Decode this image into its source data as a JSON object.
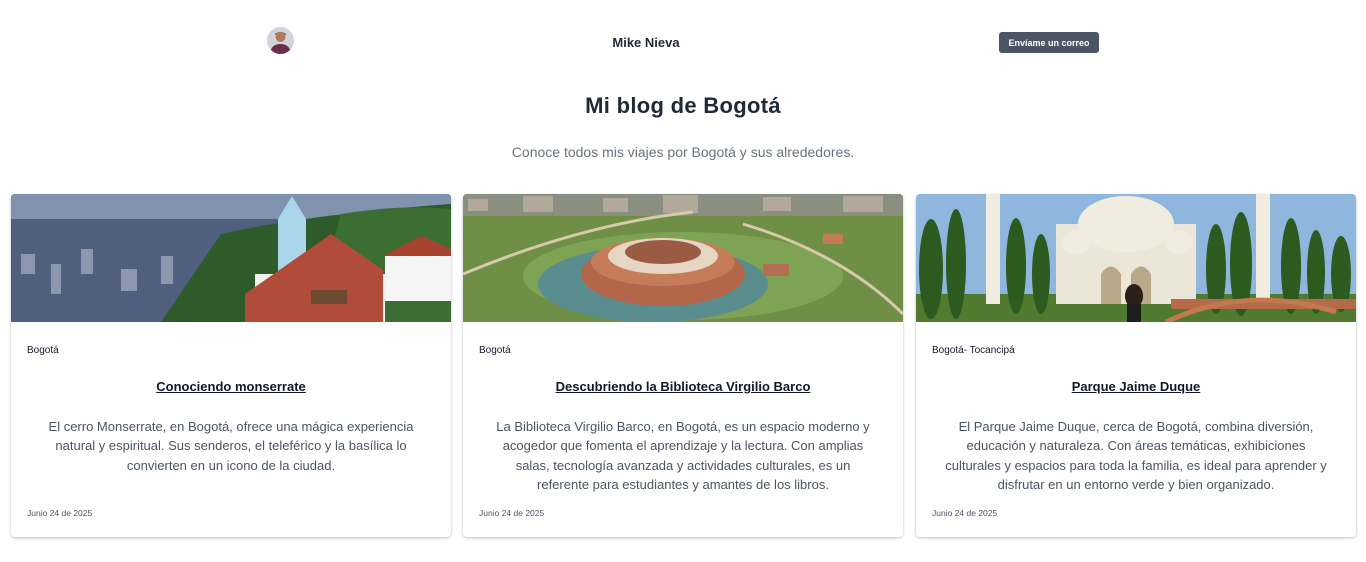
{
  "header": {
    "author_name": "Mike Nieva",
    "mail_button_label": "Envíame un correo",
    "avatar_icon": "person-avatar"
  },
  "page": {
    "title": "Mi blog de Bogotá",
    "subtitle": "Conoce todos mis viajes por Bogotá y sus alrededores."
  },
  "posts": [
    {
      "tag": "Bogotá",
      "title": "Conociendo monserrate",
      "excerpt": "El cerro Monserrate, en Bogotá, ofrece una mágica experiencia natural y espiritual. Sus senderos, el teleférico y la basílica lo convierten en un icono de la ciudad.",
      "date": "Junio 24 de 2025"
    },
    {
      "tag": "Bogotá",
      "title": "Descubriendo la Biblioteca Virgilio Barco",
      "excerpt": "La Biblioteca Virgilio Barco, en Bogotá, es un espacio moderno y acogedor que fomenta el aprendizaje y la lectura. Con amplias salas, tecnología avanzada y actividades culturales, es un referente para estudiantes y amantes de los libros.",
      "date": "Junio 24 de 2025"
    },
    {
      "tag": "Bogotá- Tocancipá",
      "title": "Parque Jaime Duque",
      "excerpt": "El Parque Jaime Duque, cerca de Bogotá, combina diversión, educación y naturaleza. Con áreas temáticas, exhibiciones culturales y espacios para toda la familia, es ideal para aprender y disfrutar en un entorno verde y bien organizado.",
      "date": "Junio 24 de 2025"
    }
  ],
  "colors": {
    "button_bg": "#4b5563",
    "heading": "#1f2937",
    "muted_text": "#6b7280"
  }
}
